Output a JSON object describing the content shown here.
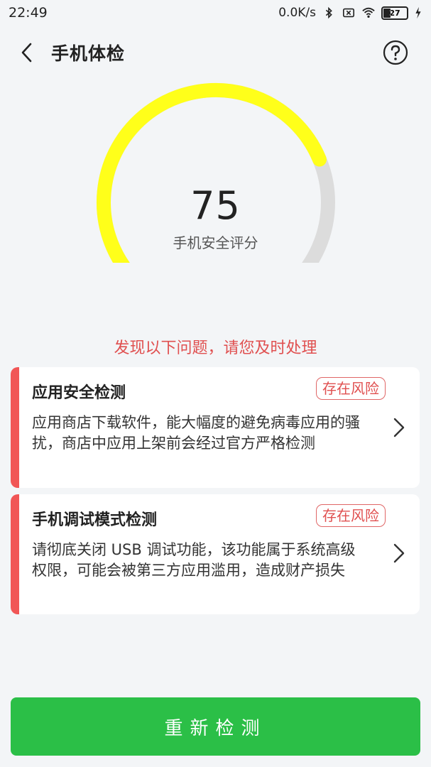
{
  "status_bar": {
    "time": "22:49",
    "speed": "0.0K/s",
    "battery": "27",
    "icons": [
      "bluetooth-icon",
      "sim-off-icon",
      "wifi-icon",
      "battery-icon",
      "charging-icon"
    ]
  },
  "header": {
    "title": "手机体检",
    "back_icon": "chevron-left-icon",
    "help_icon": "help-icon"
  },
  "gauge": {
    "score": "75",
    "label": "手机安全评分",
    "score_fraction": 0.75,
    "colors": {
      "filled": "#ffff1a",
      "track": "#dcdcdc"
    }
  },
  "notice": "发现以下问题，请您及时处理",
  "issues": [
    {
      "title": "应用安全检测",
      "badge": "存在风险",
      "description": "应用商店下载软件，能大幅度的避免病毒应用的骚扰，商店中应用上架前会经过官方严格检测"
    },
    {
      "title": "手机调试模式检测",
      "badge": "存在风险",
      "description": "请彻底关闭 USB 调试功能，该功能属于系统高级权限，可能会被第三方应用滥用，造成财产损失"
    }
  ],
  "recheck_button": "重新检测",
  "colors": {
    "risk": "#f15656",
    "button": "#2bbf47",
    "notice": "#e05050"
  }
}
